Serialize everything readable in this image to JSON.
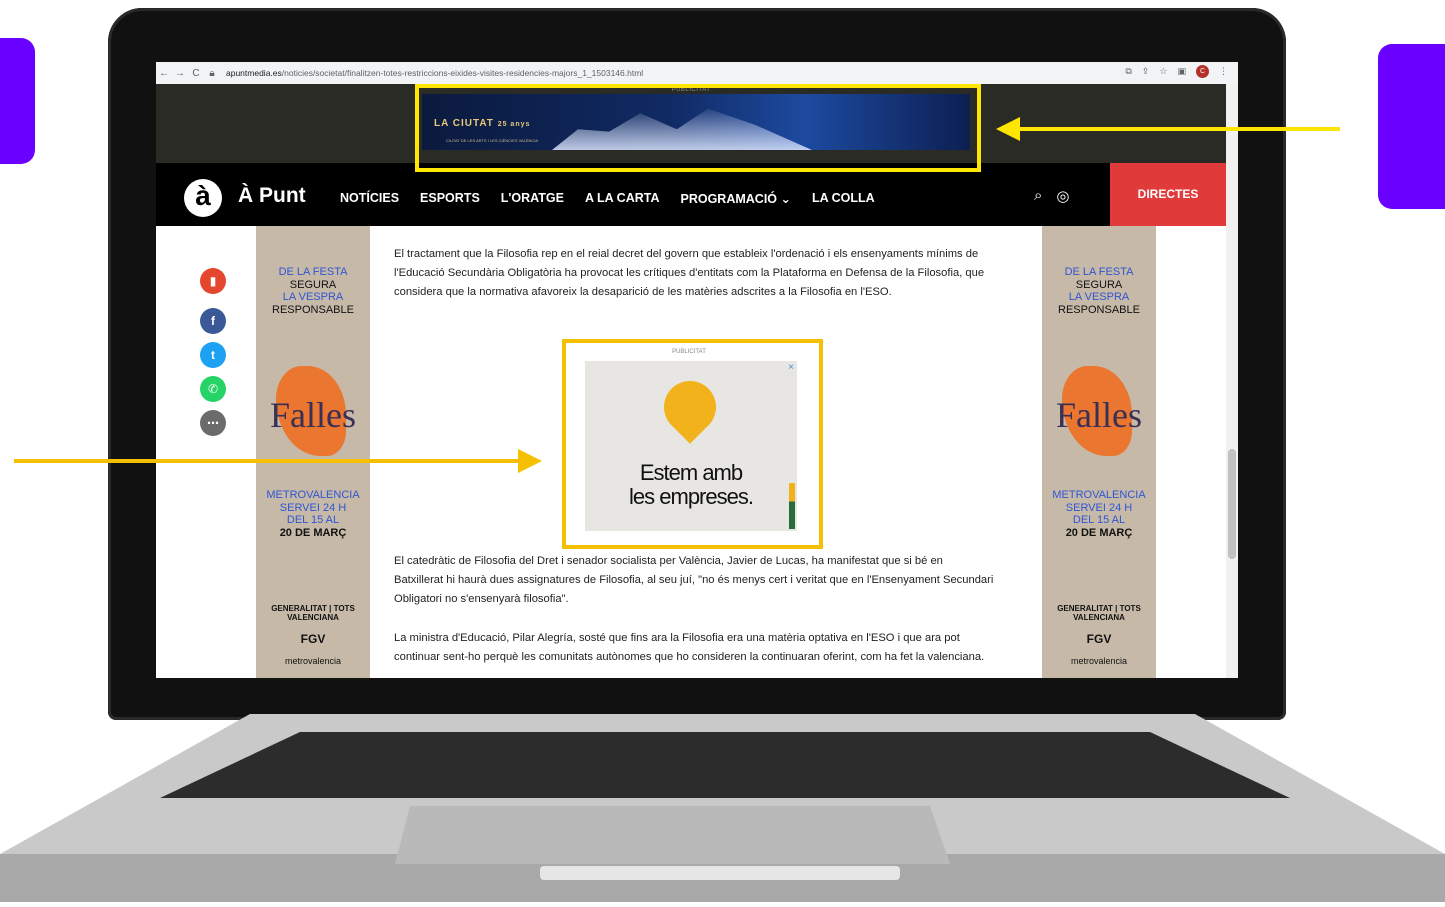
{
  "colors": {
    "accent_purple": "#6a00ff",
    "highlight_yellow": "#ffe600",
    "highlight_orange": "#f5c000",
    "directes_red": "#e03a3a"
  },
  "browser": {
    "url_domain": "apuntmedia.es",
    "url_path": "/noticies/societat/finalitzen-totes-restriccions-eixides-visites-residencies-majors_1_1503146.html",
    "profile_initial": "C"
  },
  "top_ad": {
    "label": "PUBLICITAT",
    "title": "LA CIUTAT",
    "years": "25 anys",
    "subtitle": "CIUTAT DE LES ARTS I LES CIÈNCIES VALÈNCIA"
  },
  "navbar": {
    "logo_letter": "à",
    "brand": "À Punt",
    "menu": [
      "NOTÍCIES",
      "ESPORTS",
      "L'ORATGE",
      "A LA CARTA",
      "PROGRAMACIÓ ⌄",
      "LA COLLA"
    ],
    "directes": "DIRECTES"
  },
  "side_ad": {
    "line1": "DE LA FESTA",
    "line2": "SEGURA",
    "line3": "LA VESPRA",
    "line4": "RESPONSABLE",
    "logo": "Falles",
    "info1": "METROVALENCIA",
    "info2": "SERVEI 24 H",
    "info3": "DEL 15 AL",
    "info4": "20 DE MARÇ",
    "gv": "GENERALITAT | TOTS VALENCIANA",
    "fgv": "FGV",
    "metro": "metrovalencia"
  },
  "article": {
    "p1": "El tractament que la Filosofia rep en el reial decret del govern que estableix l'ordenació i els ensenyaments mínims de l'Educació Secundària Obligatòria ha provocat les crítiques d'entitats com la Plataforma en Defensa de la Filosofia, que considera que la normativa afavoreix la desaparició de les matèries adscrites a la Filosofia en l'ESO.",
    "p2": "El catedràtic de Filosofia del Dret i senador socialista per València, Javier de Lucas, ha manifestat que si bé en Batxillerat hi haurà dues assignatures de Filosofia, al seu juí, \"no és menys cert i veritat que en l'Ensenyament Secundari Obligatori no s'ensenyarà filosofia\".",
    "p3": "La ministra d'Educació, Pilar Alegría, sosté que fins ara la Filosofia era una matèria optativa en l'ESO i que ara pot continuar sent-ho perquè les comunitats autònomes que ho consideren la continuaran oferint, com ha fet la valenciana."
  },
  "mid_ad": {
    "label": "PUBLICITAT",
    "text_line1": "Estem amb",
    "text_line2": "les empreses.",
    "close": "×"
  },
  "share_icons": [
    "bookmark-icon",
    "facebook-icon",
    "twitter-icon",
    "whatsapp-icon",
    "more-icon"
  ]
}
